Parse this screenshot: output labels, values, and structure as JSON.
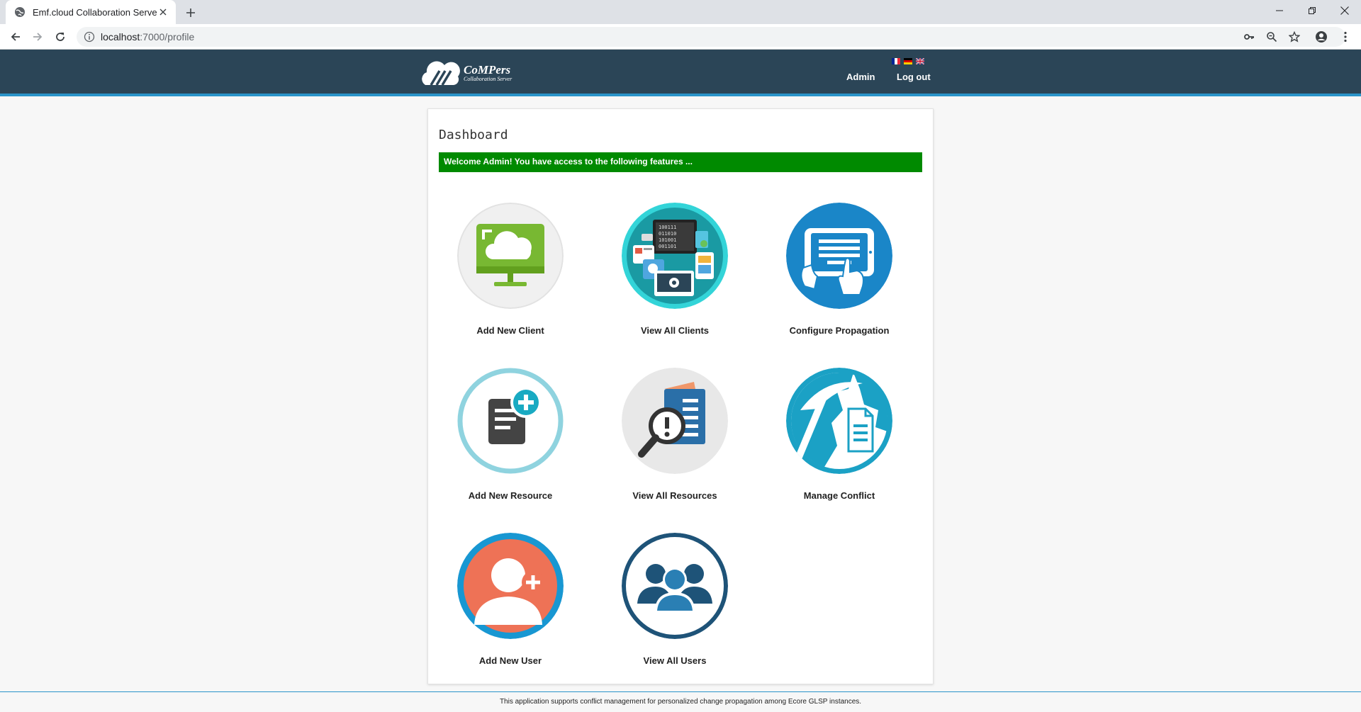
{
  "browser": {
    "tab_title": "Emf.cloud Collaboration Server",
    "url_host": "localhost",
    "url_path": ":7000/profile"
  },
  "header": {
    "logo_title": "CoMPers",
    "logo_subtitle": "Collaboration Server",
    "languages": [
      "fr",
      "de",
      "en"
    ],
    "user_link": "Admin",
    "logout_link": "Log out",
    "colors": {
      "bar": "#2b4557",
      "accent_line": "#2a94c9"
    }
  },
  "dashboard": {
    "title": "Dashboard",
    "welcome": "Welcome Admin! You have access to the following features ...",
    "welcome_color": "#008a00",
    "features": [
      {
        "label": "Add New Client",
        "icon": "cloud-monitor-icon"
      },
      {
        "label": "View All Clients",
        "icon": "devices-icon"
      },
      {
        "label": "Configure Propagation",
        "icon": "tablet-touch-icon"
      },
      {
        "label": "Add New Resource",
        "icon": "document-add-icon"
      },
      {
        "label": "View All Resources",
        "icon": "document-search-icon"
      },
      {
        "label": "Manage Conflict",
        "icon": "pickaxe-document-icon"
      },
      {
        "label": "Add New User",
        "icon": "user-add-icon"
      },
      {
        "label": "View All Users",
        "icon": "users-group-icon"
      }
    ]
  },
  "footer": {
    "text": "This application supports conflict management for personalized change propagation among Ecore GLSP instances."
  }
}
